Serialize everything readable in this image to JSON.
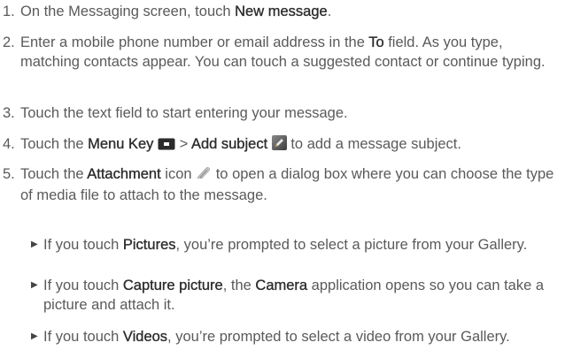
{
  "steps": [
    {
      "num": "1.",
      "a": "On the Messaging screen, touch ",
      "b": "New message",
      "c": "."
    },
    {
      "num": "2.",
      "a": "Enter a mobile phone number or email address in the ",
      "b": "To",
      "c": " field. As you type, matching contacts appear. You can touch a suggested contact or continue typing."
    },
    {
      "num": "3.",
      "text": "Touch the text field to start entering your message."
    },
    {
      "num": "4.",
      "a": "Touch the ",
      "b": "Menu Key",
      "c": " > ",
      "d": "Add subject",
      "e": " to add a message subject."
    },
    {
      "num": "5.",
      "a": "Touch the ",
      "b": "Attachment",
      "c": " icon ",
      "d": " to open a dialog box where you can choose the type of media file to attach to the message."
    }
  ],
  "bullets": [
    {
      "a": "If you touch ",
      "b": "Pictures",
      "c": ", you’re prompted to select a picture from your Gallery."
    },
    {
      "a": "If you touch ",
      "b": "Capture picture",
      "c": ", the ",
      "d": "Camera",
      "e": " application opens so you can take a picture and attach it."
    },
    {
      "a": "If you touch ",
      "b": "Videos",
      "c": ", you’re prompted to select a video from your Gallery."
    }
  ],
  "icons": {
    "menu_key": "menu-key-icon",
    "add_subject": "pencil-icon",
    "attachment": "paperclip-icon"
  }
}
